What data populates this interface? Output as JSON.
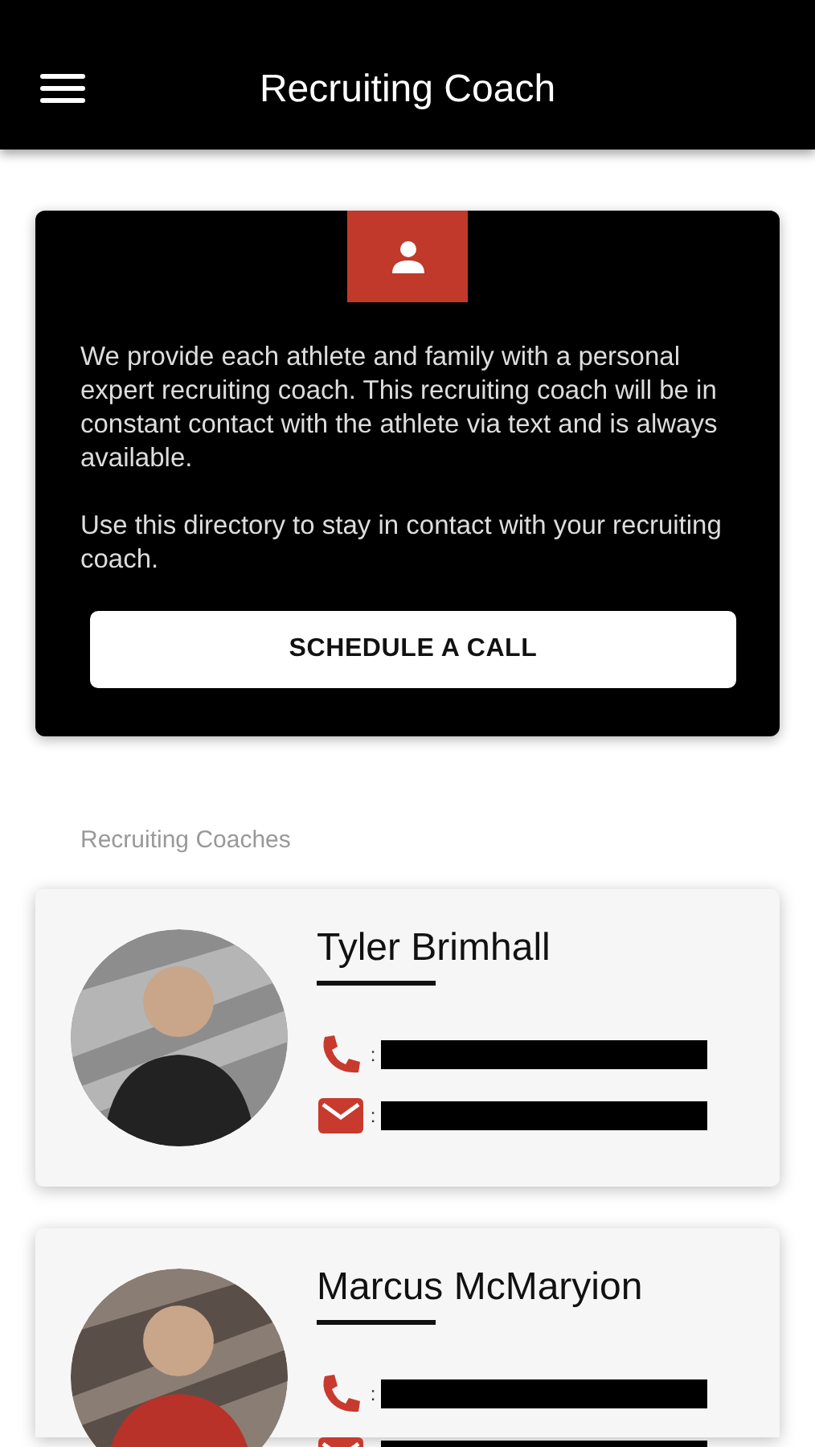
{
  "header": {
    "title": "Recruiting Coach"
  },
  "intro": {
    "paragraphs": [
      "We provide each athlete and family with a personal expert recruiting coach. This recruiting coach will be in constant contact with the athlete via text and is always available.",
      "Use this directory to stay in contact with your recruiting coach."
    ],
    "button": "SCHEDULE A CALL"
  },
  "section_label": "Recruiting Coaches",
  "coaches": [
    {
      "name": "Tyler Brimhall",
      "contacts": [
        {
          "kind": "phone",
          "separator": ":"
        },
        {
          "kind": "email",
          "separator": ":"
        }
      ]
    },
    {
      "name": "Marcus McMaryion",
      "contacts": [
        {
          "kind": "phone",
          "separator": ":"
        },
        {
          "kind": "email"
        }
      ]
    }
  ]
}
